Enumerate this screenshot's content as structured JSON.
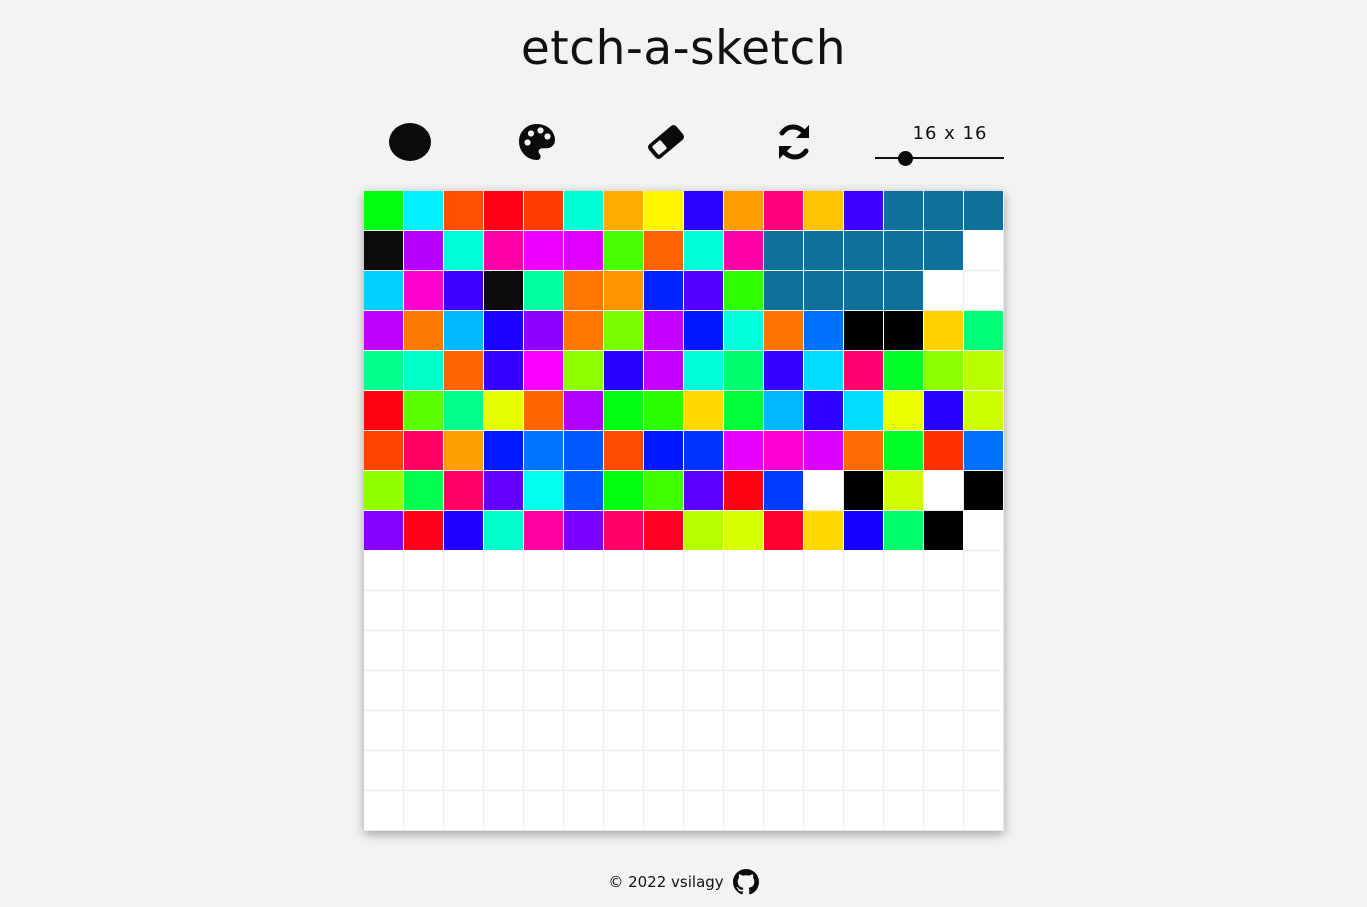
{
  "app": {
    "title": "etch-a-sketch"
  },
  "toolbar": {
    "tools": [
      {
        "name": "black-pen-icon"
      },
      {
        "name": "palette-icon"
      },
      {
        "name": "eraser-icon"
      },
      {
        "name": "refresh-icon"
      }
    ],
    "grid_size_label": "16 x 16",
    "grid_size_value": 16,
    "grid_size_min": 16,
    "grid_size_max": 100
  },
  "board": {
    "cols": 16,
    "rows": 16,
    "empty_color": "#ffffff",
    "cells": [
      [
        "#00ff0e",
        "#00f0ff",
        "#ff4f00",
        "#ff0016",
        "#ff3d00",
        "#00ffd5",
        "#ffac00",
        "#fff500",
        "#2a00ff",
        "#ff9c00",
        "#ff0080",
        "#ffc400",
        "#3e00ff",
        "#0f7099",
        "#0f7099",
        "#0f7099"
      ],
      [
        "#0b0b0b",
        "#b700ff",
        "#00ffd8",
        "#ff00a8",
        "#ee00ff",
        "#e100ff",
        "#48ff00",
        "#ff6200",
        "#00ffd9",
        "#ff00a8",
        "#0f7099",
        "#0f7099",
        "#0f7099",
        "#0f7099",
        "#0f7099",
        ""
      ],
      [
        "#00d0ff",
        "#ff00d1",
        "#3c00ff",
        "#0b0b0b",
        "#00ff9f",
        "#ff7600",
        "#ff9500",
        "#0023ff",
        "#5200ff",
        "#2dff00",
        "#0f7099",
        "#0f7099",
        "#0f7099",
        "#0f7099",
        "",
        ""
      ],
      [
        "#c000ff",
        "#ff7a00",
        "#00b8ff",
        "#1c00ff",
        "#8e00ff",
        "#ff7600",
        "#7aff00",
        "#c300ff",
        "#0018ff",
        "#00ffdb",
        "#ff7400",
        "#0070ff",
        "#000000",
        "#000000",
        "#ffd200",
        "#00ff79"
      ],
      [
        "#00ff8c",
        "#00ffc8",
        "#ff6300",
        "#3400ff",
        "#fa00ff",
        "#8fff00",
        "#2900ff",
        "#c600ff",
        "#00ffd9",
        "#00ff6e",
        "#3500ff",
        "#00ddff",
        "#ff006e",
        "#00ff28",
        "#8aff00",
        "#b9ff00"
      ],
      [
        "#ff0011",
        "#59ff00",
        "#00ff89",
        "#e6ff00",
        "#ff6600",
        "#b000ff",
        "#00ff10",
        "#2aff00",
        "#ffd900",
        "#00ff38",
        "#00b8ff",
        "#2e00ff",
        "#00ddff",
        "#ebff00",
        "#2800ff",
        "#ccff00"
      ],
      [
        "#ff4400",
        "#ff0062",
        "#ff9e00",
        "#0019ff",
        "#0073ff",
        "#0058ff",
        "#ff4b00",
        "#0018ff",
        "#0035ff",
        "#e800ff",
        "#ff00d3",
        "#db00ff",
        "#ff6b00",
        "#00ff26",
        "#ff3100",
        "#0070ff"
      ],
      [
        "#90ff00",
        "#00ff4c",
        "#ff0066",
        "#6400ff",
        "#00fff0",
        "#005dff",
        "#00ff0e",
        "#40ff00",
        "#5b00ff",
        "#ff0012",
        "#003cff",
        "",
        "#000000",
        "#d1ff00",
        "",
        "#000000"
      ],
      [
        "#8500ff",
        "#ff0018",
        "#2200ff",
        "#00ffcc",
        "#ff00a0",
        "#7a00ff",
        "#ff0065",
        "#ff0025",
        "#b6ff00",
        "#d7ff00",
        "#ff0031",
        "#ffd900",
        "#1500ff",
        "#00ff6d",
        "#000000",
        ""
      ],
      [
        "",
        "",
        "",
        "",
        "",
        "",
        "",
        "",
        "",
        "",
        "",
        "",
        "",
        "",
        "",
        ""
      ],
      [
        "",
        "",
        "",
        "",
        "",
        "",
        "",
        "",
        "",
        "",
        "",
        "",
        "",
        "",
        "",
        ""
      ],
      [
        "",
        "",
        "",
        "",
        "",
        "",
        "",
        "",
        "",
        "",
        "",
        "",
        "",
        "",
        "",
        ""
      ],
      [
        "",
        "",
        "",
        "",
        "",
        "",
        "",
        "",
        "",
        "",
        "",
        "",
        "",
        "",
        "",
        ""
      ],
      [
        "",
        "",
        "",
        "",
        "",
        "",
        "",
        "",
        "",
        "",
        "",
        "",
        "",
        "",
        "",
        ""
      ],
      [
        "",
        "",
        "",
        "",
        "",
        "",
        "",
        "",
        "",
        "",
        "",
        "",
        "",
        "",
        "",
        ""
      ],
      [
        "",
        "",
        "",
        "",
        "",
        "",
        "",
        "",
        "",
        "",
        "",
        "",
        "",
        "",
        "",
        ""
      ]
    ]
  },
  "footer": {
    "copyright": "© 2022 vsilagy",
    "github_icon": "github-icon"
  }
}
